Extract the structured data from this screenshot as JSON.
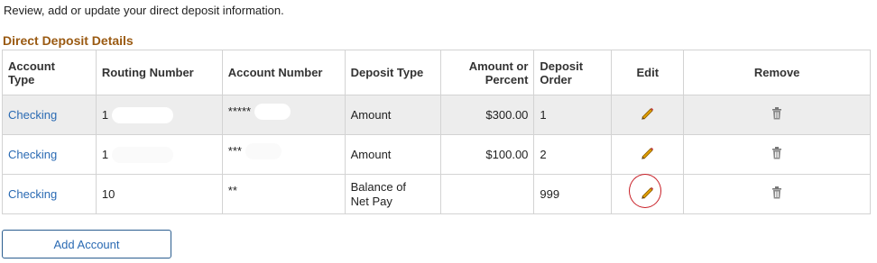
{
  "intro_text": "Review, add or update your direct deposit information.",
  "section_title": "Direct Deposit Details",
  "table": {
    "headers": {
      "account_type_line1": "Account",
      "account_type_line2": "Type",
      "routing_number": "Routing Number",
      "account_number": "Account Number",
      "deposit_type": "Deposit Type",
      "amount_line1": "Amount or",
      "amount_line2": "Percent",
      "order_line1": "Deposit",
      "order_line2": "Order",
      "edit": "Edit",
      "remove": "Remove"
    },
    "rows": [
      {
        "account_type": "Checking",
        "routing_visible": "1",
        "account_visible": "*****",
        "deposit_type_line1": "Amount",
        "deposit_type_line2": "",
        "amount": "$300.00",
        "order": "1"
      },
      {
        "account_type": "Checking",
        "routing_visible": "1",
        "account_visible": "***",
        "deposit_type_line1": "Amount",
        "deposit_type_line2": "",
        "amount": "$100.00",
        "order": "2"
      },
      {
        "account_type": "Checking",
        "routing_visible": "10",
        "account_visible": "**",
        "deposit_type_line1": "Balance of",
        "deposit_type_line2": "Net Pay",
        "amount": "",
        "order": "999"
      }
    ]
  },
  "add_account_label": "Add Account",
  "colors": {
    "section_title": "#9a5a12",
    "link": "#2a6ab3",
    "pencil": "#e0a000",
    "highlight_circle": "#c81d25",
    "row_shade": "#ededed"
  },
  "icons": {
    "edit": "pencil-icon",
    "remove": "trash-icon"
  }
}
